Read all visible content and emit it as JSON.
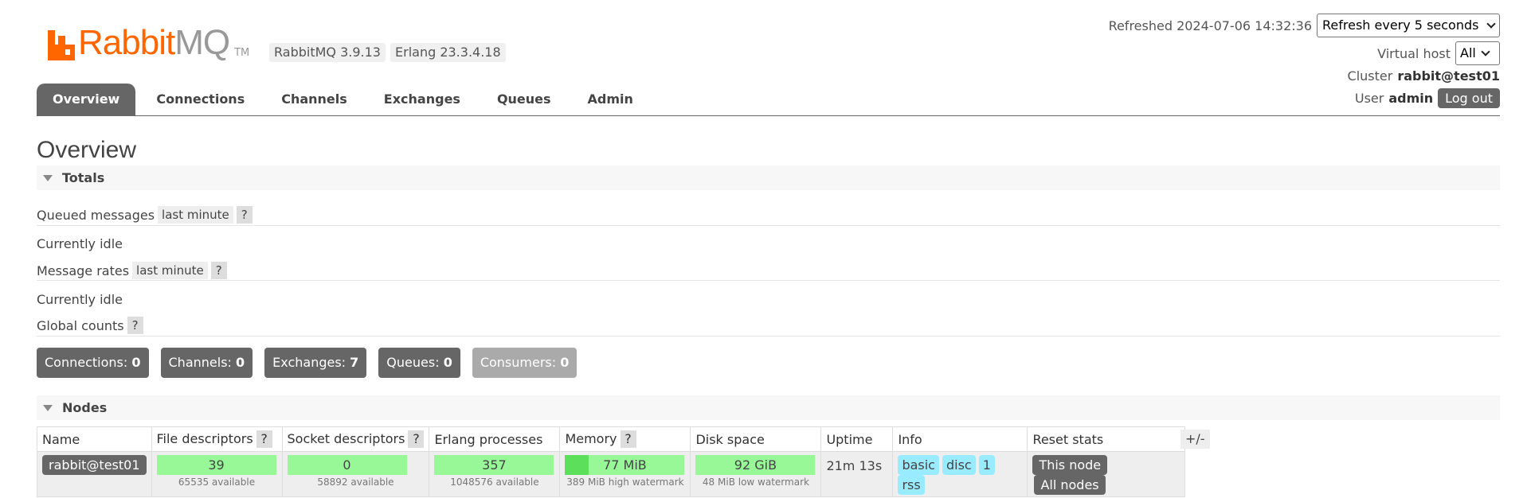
{
  "brand": {
    "word1": "Rabbit",
    "word2": "MQ",
    "tm": "TM",
    "color": "#ff6600"
  },
  "versions": {
    "rabbitmq": "RabbitMQ 3.9.13",
    "erlang": "Erlang 23.3.4.18"
  },
  "top_right": {
    "refreshed_label": "Refreshed 2024-07-06 14:32:36",
    "refresh_select": "Refresh every 5 seconds",
    "vhost_label": "Virtual host",
    "vhost_select": "All",
    "cluster_label": "Cluster",
    "cluster_value": "rabbit@test01",
    "user_label": "User",
    "user_value": "admin",
    "logout_label": "Log out"
  },
  "tabs": [
    {
      "label": "Overview",
      "active": true
    },
    {
      "label": "Connections"
    },
    {
      "label": "Channels"
    },
    {
      "label": "Exchanges"
    },
    {
      "label": "Queues"
    },
    {
      "label": "Admin"
    }
  ],
  "page_title": "Overview",
  "totals": {
    "heading": "Totals",
    "queued_label": "Queued messages",
    "queued_period": "last minute",
    "help": "?",
    "queued_status": "Currently idle",
    "rates_label": "Message rates",
    "rates_period": "last minute",
    "rates_status": "Currently idle",
    "global_label": "Global counts",
    "counts": [
      {
        "label": "Connections:",
        "value": "0"
      },
      {
        "label": "Channels:",
        "value": "0"
      },
      {
        "label": "Exchanges:",
        "value": "7"
      },
      {
        "label": "Queues:",
        "value": "0"
      },
      {
        "label": "Consumers:",
        "value": "0"
      }
    ]
  },
  "nodes": {
    "heading": "Nodes",
    "columns": [
      "Name",
      "File descriptors",
      "Socket descriptors",
      "Erlang processes",
      "Memory",
      "Disk space",
      "Uptime",
      "Info",
      "Reset stats"
    ],
    "toggle_columns": "+/-",
    "row": {
      "name": "rabbit@test01",
      "file_descriptors": {
        "value": "39",
        "sub": "65535 available"
      },
      "socket_descriptors": {
        "value": "0",
        "sub": "58892 available"
      },
      "erlang_processes": {
        "value": "357",
        "sub": "1048576 available"
      },
      "memory": {
        "value": "77 MiB",
        "sub": "389 MiB high watermark",
        "usage_fraction": 0.2
      },
      "disk_space": {
        "value": "92 GiB",
        "sub": "48 MiB low watermark"
      },
      "uptime": "21m 13s",
      "info": [
        "basic",
        "disc",
        "1",
        "rss"
      ],
      "reset_this": "This node",
      "reset_all": "All nodes"
    }
  }
}
